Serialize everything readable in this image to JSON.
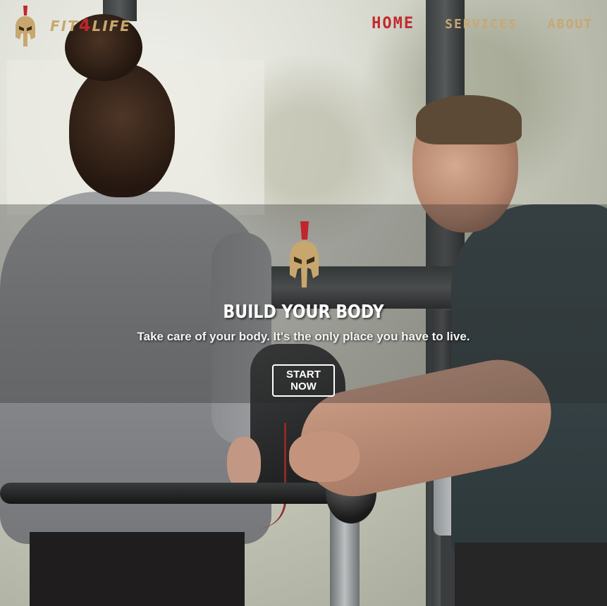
{
  "header": {
    "brand": {
      "prefix": "FIT",
      "accent": "4",
      "suffix": "LIFE"
    },
    "nav": [
      {
        "label": "HOME",
        "active": true
      },
      {
        "label": "SERVICES",
        "active": false
      },
      {
        "label": "ABOUT",
        "active": false
      }
    ]
  },
  "hero": {
    "title": "BUILD YOUR BODY",
    "subtitle": "Take care of your body. It's the only place you have to live.",
    "cta_label": "START NOW"
  },
  "colors": {
    "gold": "#c8a76e",
    "red": "#c0262b",
    "white": "#ffffff"
  },
  "icons": {
    "logo": "spartan-helmet-icon",
    "hero_logo": "spartan-helmet-icon"
  }
}
